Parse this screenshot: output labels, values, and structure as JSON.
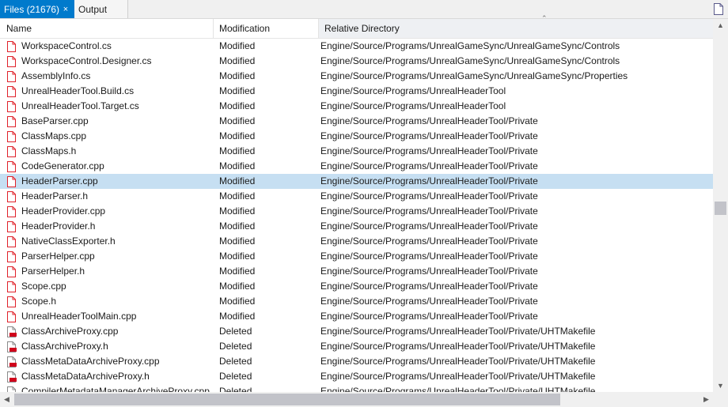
{
  "tabs": [
    {
      "label": "Files (21676)",
      "active": true,
      "close": "×"
    },
    {
      "label": "Output",
      "active": false
    }
  ],
  "columns": {
    "name": "Name",
    "modification": "Modification",
    "directory": "Relative Directory"
  },
  "sort_indicator": "ascending",
  "selected_row": 9,
  "colors": {
    "selection": "#c6dff2",
    "active_tab": "#007acc",
    "modified_icon": "#e0212a",
    "deleted_badge": "#d0021b"
  },
  "rows": [
    {
      "name": "WorkspaceControl.cs",
      "modification": "Modified",
      "directory": "Engine/Source/Programs/UnrealGameSync/UnrealGameSync/Controls",
      "icon": "modified-file-icon"
    },
    {
      "name": "WorkspaceControl.Designer.cs",
      "modification": "Modified",
      "directory": "Engine/Source/Programs/UnrealGameSync/UnrealGameSync/Controls",
      "icon": "modified-file-icon"
    },
    {
      "name": "AssemblyInfo.cs",
      "modification": "Modified",
      "directory": "Engine/Source/Programs/UnrealGameSync/UnrealGameSync/Properties",
      "icon": "modified-file-icon"
    },
    {
      "name": "UnrealHeaderTool.Build.cs",
      "modification": "Modified",
      "directory": "Engine/Source/Programs/UnrealHeaderTool",
      "icon": "modified-file-icon"
    },
    {
      "name": "UnrealHeaderTool.Target.cs",
      "modification": "Modified",
      "directory": "Engine/Source/Programs/UnrealHeaderTool",
      "icon": "modified-file-icon"
    },
    {
      "name": "BaseParser.cpp",
      "modification": "Modified",
      "directory": "Engine/Source/Programs/UnrealHeaderTool/Private",
      "icon": "modified-file-icon"
    },
    {
      "name": "ClassMaps.cpp",
      "modification": "Modified",
      "directory": "Engine/Source/Programs/UnrealHeaderTool/Private",
      "icon": "modified-file-icon"
    },
    {
      "name": "ClassMaps.h",
      "modification": "Modified",
      "directory": "Engine/Source/Programs/UnrealHeaderTool/Private",
      "icon": "modified-file-icon"
    },
    {
      "name": "CodeGenerator.cpp",
      "modification": "Modified",
      "directory": "Engine/Source/Programs/UnrealHeaderTool/Private",
      "icon": "modified-file-icon"
    },
    {
      "name": "HeaderParser.cpp",
      "modification": "Modified",
      "directory": "Engine/Source/Programs/UnrealHeaderTool/Private",
      "icon": "modified-file-icon"
    },
    {
      "name": "HeaderParser.h",
      "modification": "Modified",
      "directory": "Engine/Source/Programs/UnrealHeaderTool/Private",
      "icon": "modified-file-icon"
    },
    {
      "name": "HeaderProvider.cpp",
      "modification": "Modified",
      "directory": "Engine/Source/Programs/UnrealHeaderTool/Private",
      "icon": "modified-file-icon"
    },
    {
      "name": "HeaderProvider.h",
      "modification": "Modified",
      "directory": "Engine/Source/Programs/UnrealHeaderTool/Private",
      "icon": "modified-file-icon"
    },
    {
      "name": "NativeClassExporter.h",
      "modification": "Modified",
      "directory": "Engine/Source/Programs/UnrealHeaderTool/Private",
      "icon": "modified-file-icon"
    },
    {
      "name": "ParserHelper.cpp",
      "modification": "Modified",
      "directory": "Engine/Source/Programs/UnrealHeaderTool/Private",
      "icon": "modified-file-icon"
    },
    {
      "name": "ParserHelper.h",
      "modification": "Modified",
      "directory": "Engine/Source/Programs/UnrealHeaderTool/Private",
      "icon": "modified-file-icon"
    },
    {
      "name": "Scope.cpp",
      "modification": "Modified",
      "directory": "Engine/Source/Programs/UnrealHeaderTool/Private",
      "icon": "modified-file-icon"
    },
    {
      "name": "Scope.h",
      "modification": "Modified",
      "directory": "Engine/Source/Programs/UnrealHeaderTool/Private",
      "icon": "modified-file-icon"
    },
    {
      "name": "UnrealHeaderToolMain.cpp",
      "modification": "Modified",
      "directory": "Engine/Source/Programs/UnrealHeaderTool/Private",
      "icon": "modified-file-icon"
    },
    {
      "name": "ClassArchiveProxy.cpp",
      "modification": "Deleted",
      "directory": "Engine/Source/Programs/UnrealHeaderTool/Private/UHTMakefile",
      "icon": "deleted-file-icon"
    },
    {
      "name": "ClassArchiveProxy.h",
      "modification": "Deleted",
      "directory": "Engine/Source/Programs/UnrealHeaderTool/Private/UHTMakefile",
      "icon": "deleted-file-icon"
    },
    {
      "name": "ClassMetaDataArchiveProxy.cpp",
      "modification": "Deleted",
      "directory": "Engine/Source/Programs/UnrealHeaderTool/Private/UHTMakefile",
      "icon": "deleted-file-icon"
    },
    {
      "name": "ClassMetaDataArchiveProxy.h",
      "modification": "Deleted",
      "directory": "Engine/Source/Programs/UnrealHeaderTool/Private/UHTMakefile",
      "icon": "deleted-file-icon"
    },
    {
      "name": "CompilerMetadataManagerArchiveProxy.cpp",
      "modification": "Deleted",
      "directory": "Engine/Source/Programs/UnrealHeaderTool/Private/UHTMakefile",
      "icon": "deleted-file-icon"
    }
  ]
}
